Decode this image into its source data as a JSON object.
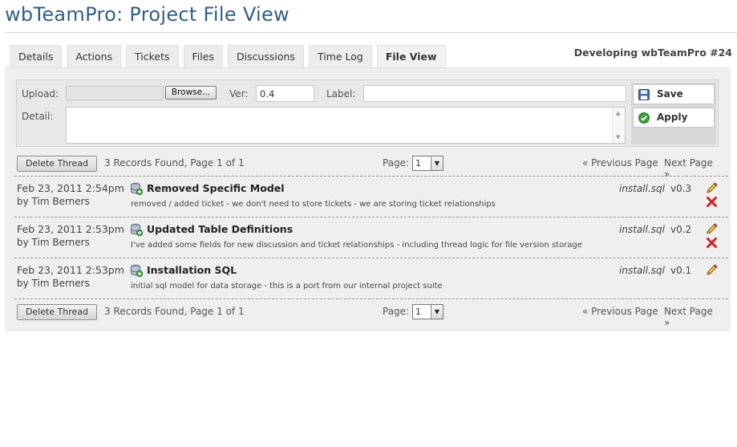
{
  "header": {
    "title": "wbTeamPro: Project File View",
    "project_label": "Developing wbTeamPro #24"
  },
  "tabs": [
    {
      "label": "Details",
      "active": false
    },
    {
      "label": "Actions",
      "active": false
    },
    {
      "label": "Tickets",
      "active": false
    },
    {
      "label": "Files",
      "active": false
    },
    {
      "label": "Discussions",
      "active": false
    },
    {
      "label": "Time Log",
      "active": false
    },
    {
      "label": "File View",
      "active": true
    }
  ],
  "form": {
    "upload_label": "Upload:",
    "browse_label": "Browse...",
    "ver_label": "Ver:",
    "ver_value": "0.4",
    "label_label": "Label:",
    "label_value": "",
    "detail_label": "Detail:",
    "detail_value": "",
    "save_label": "Save",
    "apply_label": "Apply"
  },
  "pager": {
    "delete_label": "Delete Thread",
    "records": "3 Records Found, Page 1 of 1",
    "page_label": "Page:",
    "page_value": "1",
    "prev_label": "« Previous Page",
    "next_label": "Next Page »"
  },
  "records": [
    {
      "date": "Feb 23, 2011 2:54pm",
      "by": "by Tim Berners",
      "title": "Removed Specific Model",
      "desc": "removed / added ticket - we don't need to store tickets - we are storing ticket relationships",
      "file": "install.sql",
      "version": "v0.3",
      "deletable": true
    },
    {
      "date": "Feb 23, 2011 2:53pm",
      "by": "by Tim Berners",
      "title": "Updated Table Definitions",
      "desc": "I've added some fields for new discussion and ticket relationships - including thread logic for file version storage",
      "file": "install.sql",
      "version": "v0.2",
      "deletable": true
    },
    {
      "date": "Feb 23, 2011 2:53pm",
      "by": "by Tim Berners",
      "title": "Installation SQL",
      "desc": "initial sql model for data storage - this is a port from our internal project suite",
      "file": "install.sql",
      "version": "v0.1",
      "deletable": false
    }
  ],
  "colors": {
    "title": "#2e5f8a",
    "panel": "#efefef",
    "delete_red": "#d42020",
    "apply_green": "#3aa23a"
  },
  "icons": {
    "record": "database-add-icon",
    "edit": "pencil-icon",
    "delete": "red-x-icon",
    "save": "floppy-disk-icon",
    "apply": "green-check-icon"
  }
}
